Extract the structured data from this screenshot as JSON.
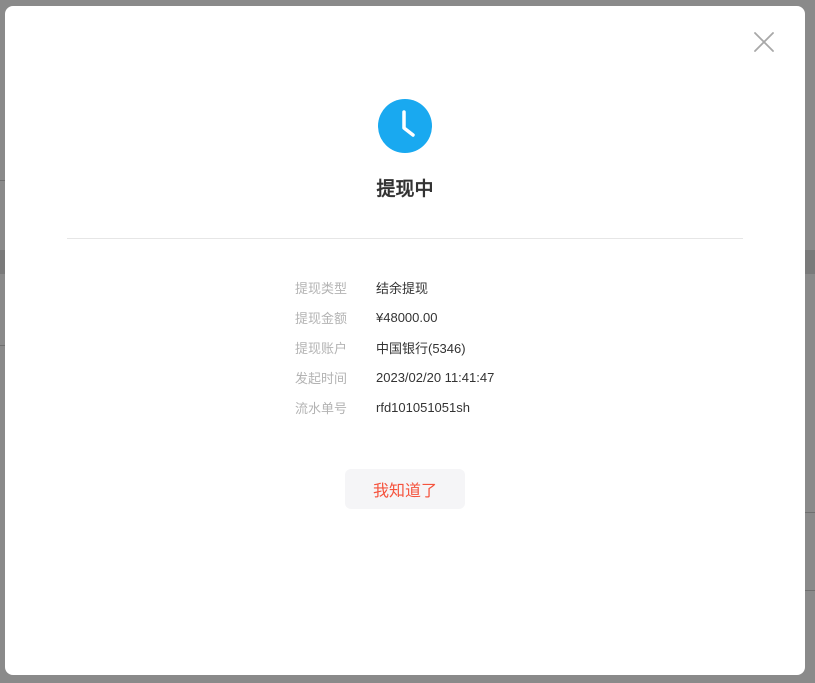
{
  "status": {
    "title": "提现中",
    "icon": "clock-icon",
    "accent": "#19a9f0"
  },
  "details": [
    {
      "label": "提现类型",
      "value": "结余提现"
    },
    {
      "label": "提现金额",
      "value": "¥48000.00"
    },
    {
      "label": "提现账户",
      "value": "中国银行(5346)"
    },
    {
      "label": "发起时间",
      "value": "2023/02/20 11:41:47"
    },
    {
      "label": "流水单号",
      "value": "rfd101051051sh"
    }
  ],
  "actions": {
    "confirm_label": "我知道了",
    "confirm_color": "#f5533d"
  }
}
